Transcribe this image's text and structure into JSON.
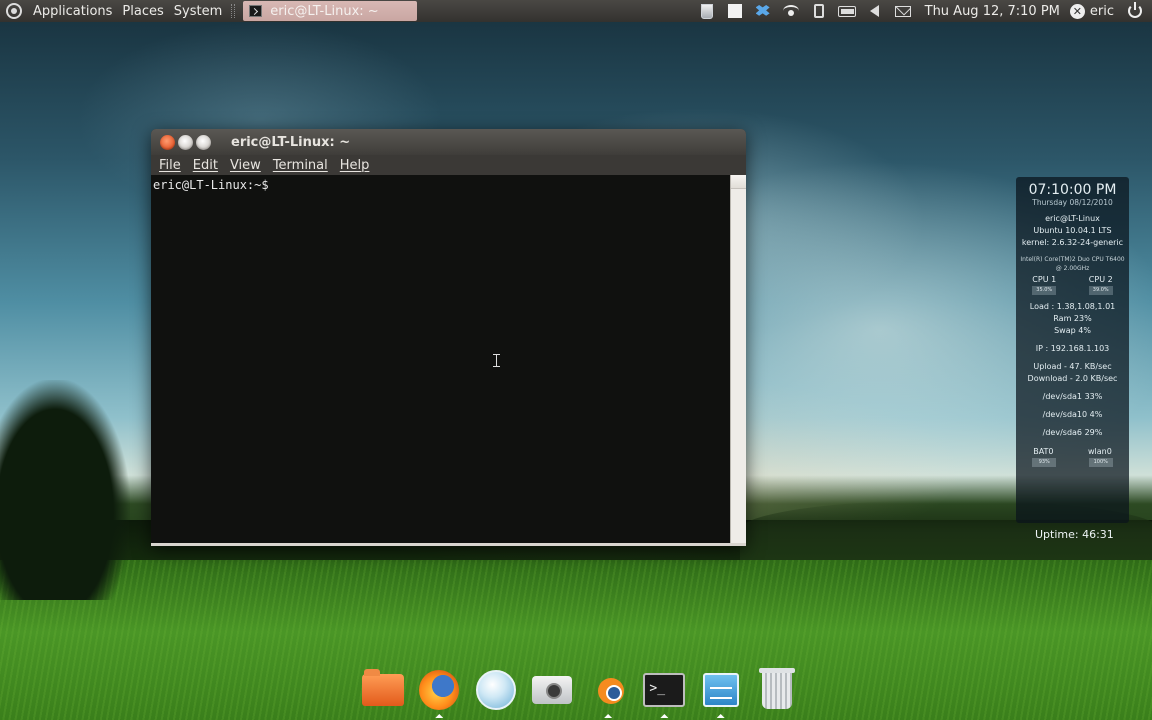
{
  "top_panel": {
    "menus": [
      "Applications",
      "Places",
      "System"
    ],
    "task_button": "eric@LT-Linux: ~",
    "tray_icons": [
      "trash-icon",
      "white-square-icon",
      "dropbox-icon",
      "wifi-icon",
      "phone-icon",
      "battery-icon",
      "volume-icon",
      "mail-icon"
    ],
    "clock": "Thu Aug 12,  7:10 PM",
    "user": "eric"
  },
  "terminal": {
    "title": "eric@LT-Linux: ~",
    "menu": [
      "File",
      "Edit",
      "View",
      "Terminal",
      "Help"
    ],
    "prompt": "eric@LT-Linux:~$"
  },
  "conky": {
    "time": "07:10:00 PM",
    "date": "Thursday 08/12/2010",
    "host": "eric@LT-Linux",
    "os": "Ubuntu 10.04.1 LTS",
    "kernel": "kernel: 2.6.32-24-generic",
    "cpu_model": "Intel(R) Core(TM)2 Duo CPU     T6400",
    "cpu_freq": "@ 2.00GHz",
    "cpu1_label": "CPU 1",
    "cpu2_label": "CPU 2",
    "cpu1_value": "35.0%",
    "cpu2_value": "39.0%",
    "load": "Load : 1.38,1.08,1.01",
    "ram": "Ram 23%",
    "swap": "Swap 4%",
    "ip": "IP : 192.168.1.103",
    "upload": "Upload - 47. KB/sec",
    "download": "Download - 2.0 KB/sec",
    "disk1": "/dev/sda1 33%",
    "disk2": "/dev/sda10 4%",
    "disk3": "/dev/sda6 29%",
    "bat_label": "BAT0",
    "wlan_label": "wlan0",
    "bat_value": "93%",
    "wlan_value": "100%",
    "uptime": "Uptime: 46:31"
  },
  "dock": {
    "items": [
      "folder-icon",
      "firefox-icon",
      "web-browser-icon",
      "camera-icon",
      "blender-icon",
      "terminal-icon",
      "system-monitor-icon",
      "trash-icon"
    ],
    "terminal_glyph": ">_"
  }
}
